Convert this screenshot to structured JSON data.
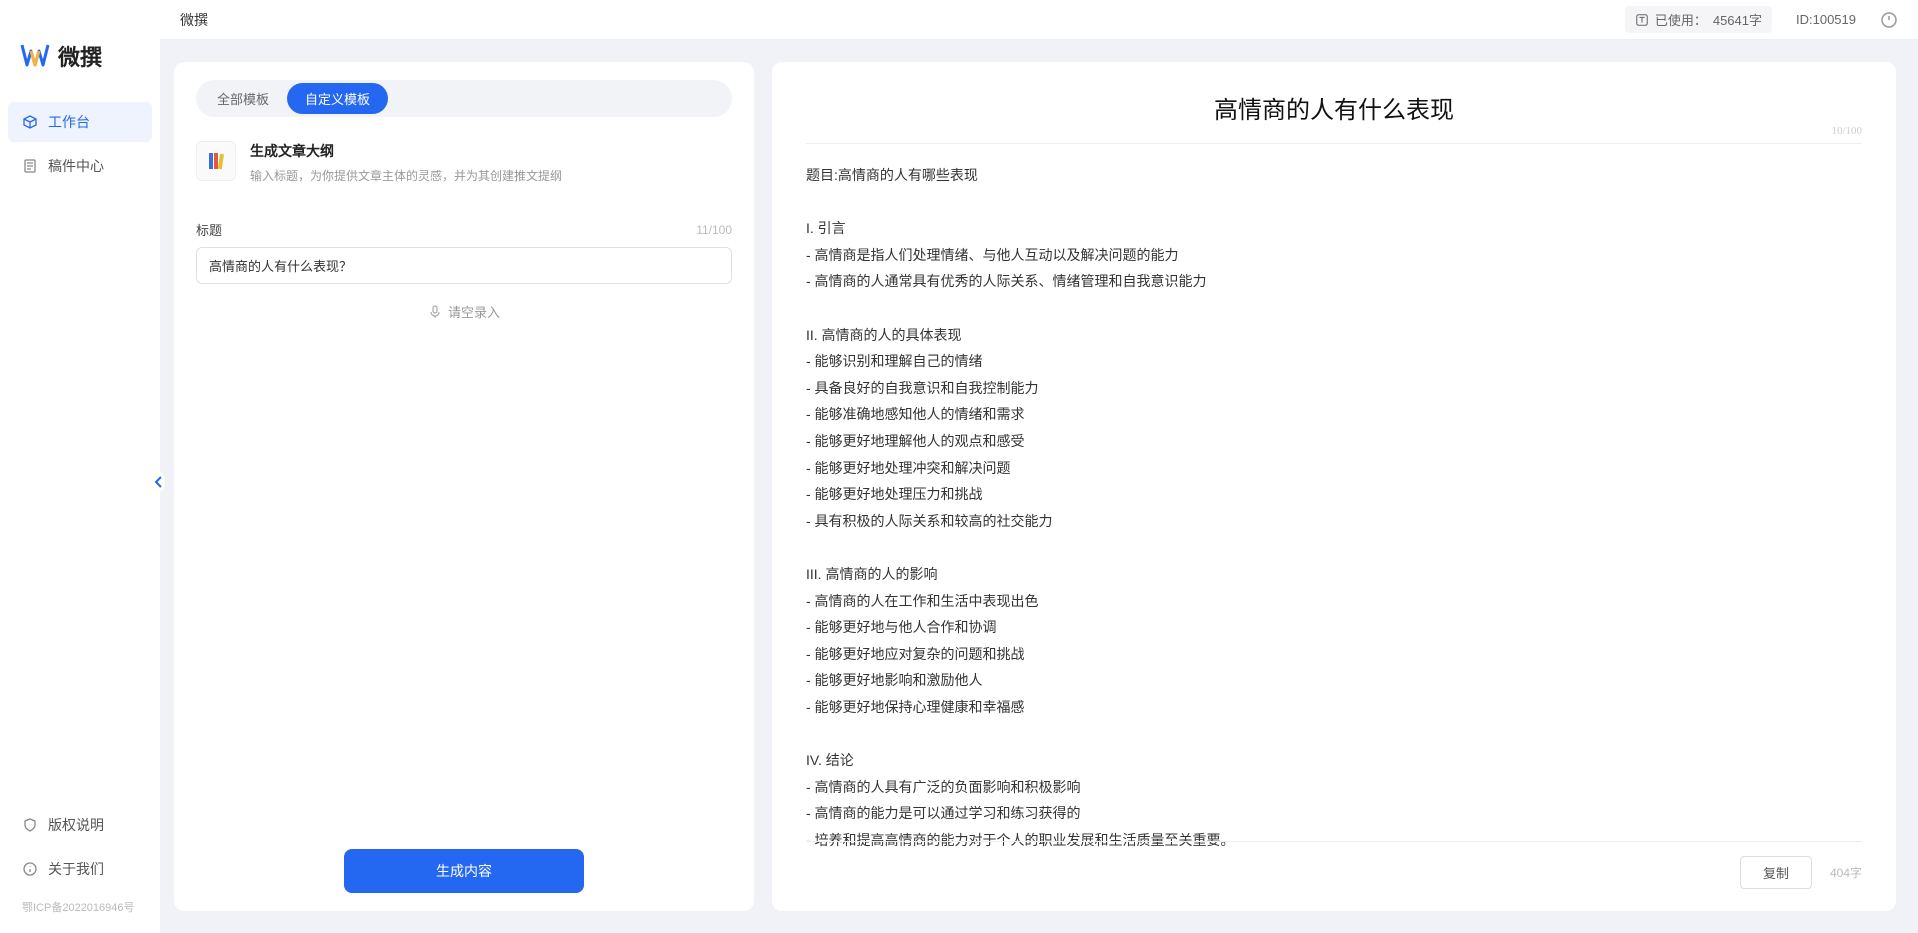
{
  "app": {
    "title": "微撰",
    "logo_text": "微撰"
  },
  "topbar": {
    "usage_label": "已使用：",
    "usage_value": "45641字",
    "id_label": "ID:100519"
  },
  "sidebar": {
    "items": [
      {
        "label": "工作台",
        "active": true
      },
      {
        "label": "稿件中心",
        "active": false
      }
    ],
    "bottom": [
      {
        "label": "版权说明"
      },
      {
        "label": "关于我们"
      }
    ],
    "icp": "鄂ICP备2022016946号"
  },
  "left": {
    "tabs": [
      {
        "label": "全部模板",
        "active": false
      },
      {
        "label": "自定义模板",
        "active": true
      }
    ],
    "template": {
      "title": "生成文章大纲",
      "desc": "输入标题，为你提供文章主体的灵感，并为其创建推文提纲"
    },
    "field": {
      "label": "标题",
      "counter": "11/100",
      "value": "高情商的人有什么表现？"
    },
    "voice_label": "请空录入",
    "generate_label": "生成内容"
  },
  "result": {
    "title": "高情商的人有什么表现",
    "title_counter": "10/100",
    "body": "题目:高情商的人有哪些表现\n\nI. 引言\n- 高情商是指人们处理情绪、与他人互动以及解决问题的能力\n- 高情商的人通常具有优秀的人际关系、情绪管理和自我意识能力\n\nII. 高情商的人的具体表现\n- 能够识别和理解自己的情绪\n- 具备良好的自我意识和自我控制能力\n- 能够准确地感知他人的情绪和需求\n- 能够更好地理解他人的观点和感受\n- 能够更好地处理冲突和解决问题\n- 能够更好地处理压力和挑战\n- 具有积极的人际关系和较高的社交能力\n\nIII. 高情商的人的影响\n- 高情商的人在工作和生活中表现出色\n- 能够更好地与他人合作和协调\n- 能够更好地应对复杂的问题和挑战\n- 能够更好地影响和激励他人\n- 能够更好地保持心理健康和幸福感\n\nIV. 结论\n- 高情商的人具有广泛的负面影响和积极影响\n- 高情商的能力是可以通过学习和练习获得的\n- 培养和提高高情商的能力对于个人的职业发展和生活质量至关重要。",
    "copy_label": "复制",
    "word_count": "404字"
  }
}
